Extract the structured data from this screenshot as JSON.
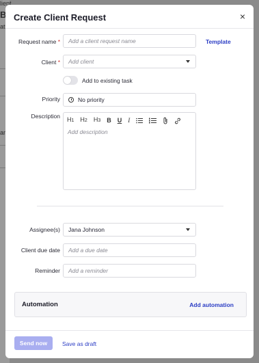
{
  "background": {
    "fragments": [
      "lient",
      "B",
      "ati",
      "ans"
    ]
  },
  "modal": {
    "title": "Create Client Request",
    "close_glyph": "×"
  },
  "form": {
    "request_name": {
      "label": "Request name",
      "required_mark": "*",
      "placeholder": "Add a client request name",
      "template_link": "Template"
    },
    "client": {
      "label": "Client",
      "required_mark": "*",
      "placeholder": "Add client"
    },
    "add_to_task": {
      "label": "Add to existing task",
      "enabled": false
    },
    "priority": {
      "label": "Priority",
      "value": "No priority",
      "icon": "clock-icon"
    },
    "description": {
      "label": "Description",
      "placeholder": "Add description",
      "toolbar": [
        "H1",
        "H2",
        "H3",
        "B",
        "U",
        "I"
      ],
      "toolbar_icons": [
        "bullet-list-icon",
        "numbered-list-icon",
        "attachment-icon",
        "link-icon"
      ]
    },
    "assignees": {
      "label": "Assignee(s)",
      "value": "Jana Johnson"
    },
    "client_due_date": {
      "label": "Client due date",
      "placeholder": "Add a due date"
    },
    "reminder": {
      "label": "Reminder",
      "placeholder": "Add a reminder"
    }
  },
  "automation": {
    "title": "Automation",
    "link": "Add automation"
  },
  "footer": {
    "send_label": "Send now",
    "draft_label": "Save as draft"
  },
  "colors": {
    "accent": "#2a3cc4",
    "send_disabled": "#a9aef0",
    "required": "#d0362f"
  }
}
